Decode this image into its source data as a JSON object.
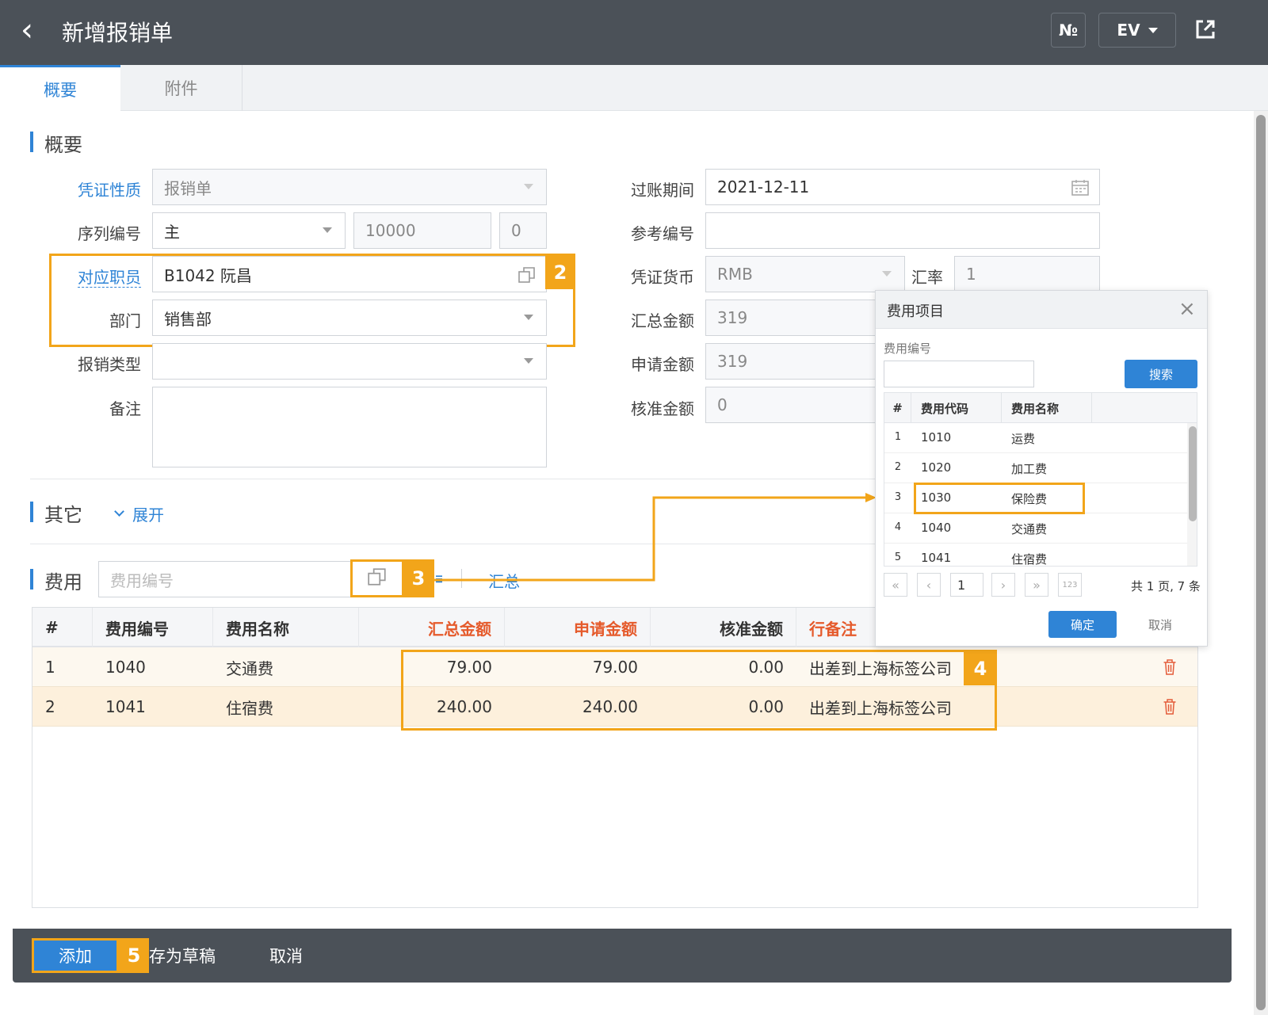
{
  "header": {
    "back_icon": "‹",
    "title": "新增报销单",
    "btn_no": "№",
    "btn_ev": "EV",
    "share_icon": "export-icon"
  },
  "tabs": [
    {
      "label": "概要"
    },
    {
      "label": "附件"
    }
  ],
  "summary": {
    "section_title": "概要",
    "voucher_type": {
      "label": "凭证性质",
      "value": "报销单"
    },
    "serial": {
      "label": "序列编号",
      "value": "主",
      "number": "10000",
      "suffix": "0"
    },
    "employee": {
      "label": "对应职员",
      "value": "B1042 阮昌"
    },
    "department": {
      "label": "部门",
      "value": "销售部"
    },
    "expense_type": {
      "label": "报销类型",
      "value": ""
    },
    "remark": {
      "label": "备注",
      "value": ""
    },
    "posting_period": {
      "label": "过账期间",
      "value": "2021-12-11"
    },
    "reference_no": {
      "label": "参考编号",
      "value": ""
    },
    "currency": {
      "label": "凭证货币",
      "value": "RMB"
    },
    "exchange_rate": {
      "label": "汇率",
      "value": "1"
    },
    "total_amount": {
      "label": "汇总金额",
      "value": "319"
    },
    "request_amount": {
      "label": "申请金额",
      "value": "319"
    },
    "approved_amount": {
      "label": "核准金额",
      "value": "0"
    }
  },
  "other": {
    "section_title": "其它",
    "expand": "展开"
  },
  "expense": {
    "section_title": "费用",
    "input_placeholder": "费用编号",
    "summary_link": "汇总",
    "columns": [
      "#",
      "费用编号",
      "费用名称",
      "汇总金额",
      "申请金额",
      "核准金额",
      "行备注"
    ],
    "rows": [
      {
        "idx": "1",
        "code": "1040",
        "name": "交通费",
        "total": "79.00",
        "request": "79.00",
        "approved": "0.00",
        "note": "出差到上海标签公司"
      },
      {
        "idx": "2",
        "code": "1041",
        "name": "住宿费",
        "total": "240.00",
        "request": "240.00",
        "approved": "0.00",
        "note": "出差到上海标签公司"
      }
    ]
  },
  "popup": {
    "title": "费用项目",
    "search_label": "费用编号",
    "search_value": "",
    "search_button": "搜索",
    "columns": [
      "#",
      "费用代码",
      "费用名称"
    ],
    "rows": [
      {
        "idx": "1",
        "code": "1010",
        "name": "运费"
      },
      {
        "idx": "2",
        "code": "1020",
        "name": "加工费"
      },
      {
        "idx": "3",
        "code": "1030",
        "name": "保险费"
      },
      {
        "idx": "4",
        "code": "1040",
        "name": "交通费"
      },
      {
        "idx": "5",
        "code": "1041",
        "name": "住宿费"
      }
    ],
    "page_value": "1",
    "page_info": "共 1 页, 7 条",
    "confirm": "确定",
    "cancel": "取消"
  },
  "badges": {
    "b2": "2",
    "b3": "3",
    "b4": "4",
    "b5": "5"
  },
  "footer": {
    "add": "添加",
    "draft": "存为草稿",
    "cancel": "取消"
  },
  "colors": {
    "accent": "#2f84d6",
    "highlight": "#f2a51a",
    "header_bg": "#4b5158",
    "required_red": "#e55a2b"
  }
}
